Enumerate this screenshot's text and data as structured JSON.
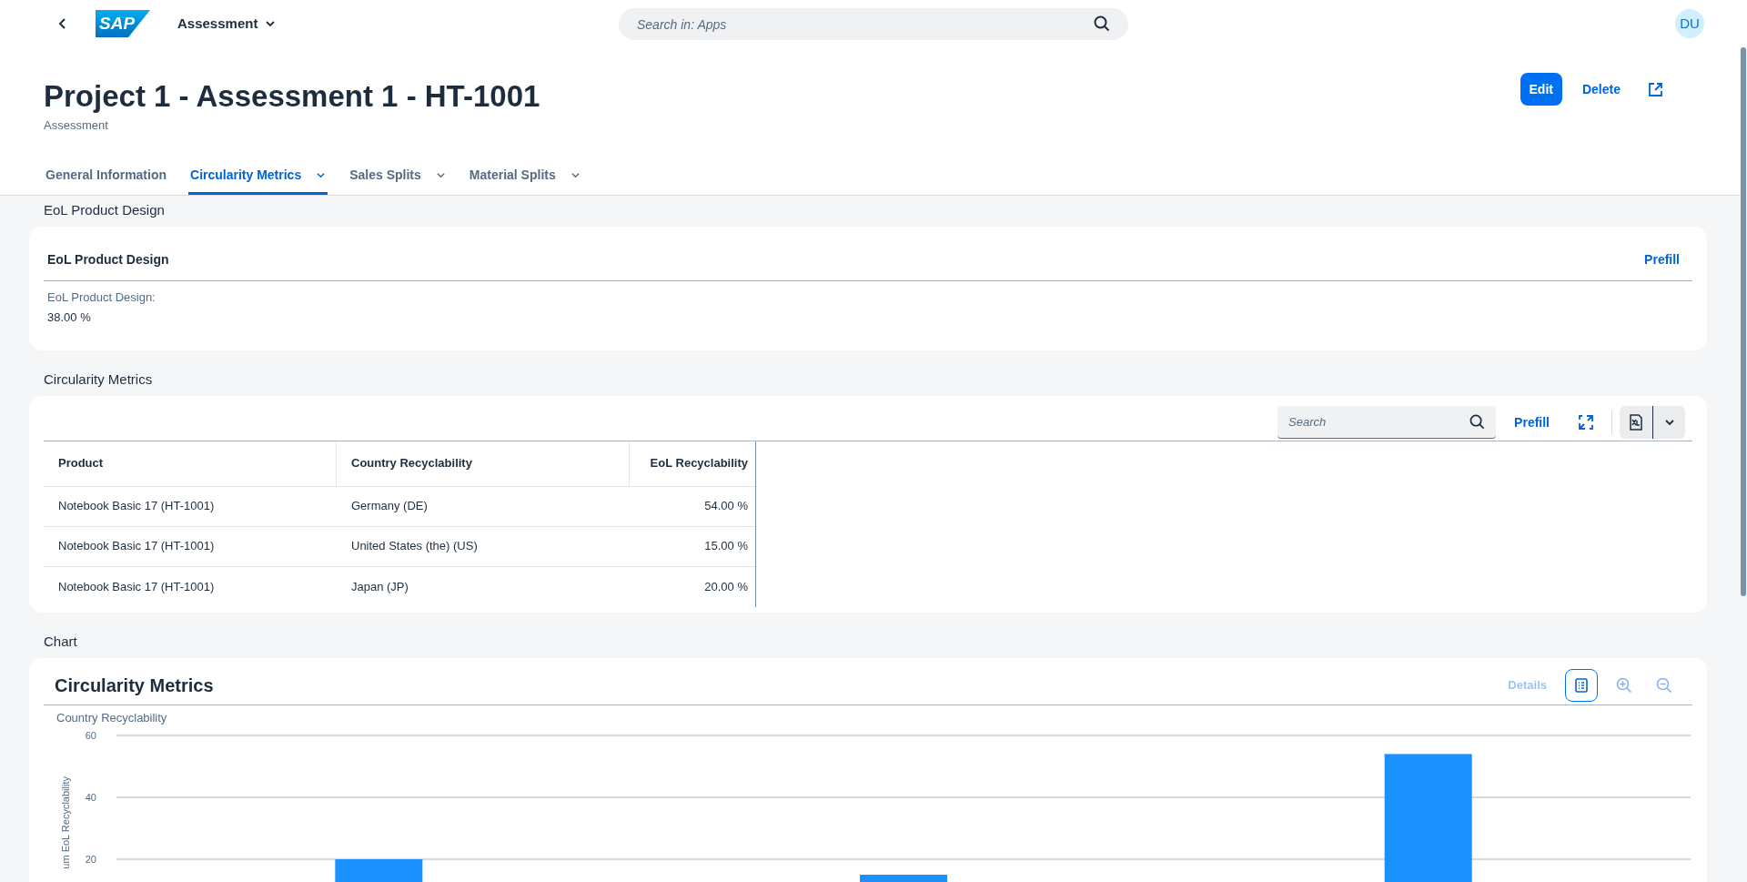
{
  "shell_bar": {
    "logo_text": "SAP",
    "app_title": "Assessment",
    "search": {
      "placeholder": "Search in: Apps"
    },
    "avatar": "DU"
  },
  "header": {
    "title": "Project 1 - Assessment 1 - HT-1001",
    "subtitle": "Assessment",
    "actions": [
      {
        "label": "Edit",
        "kind": "emphasized"
      },
      {
        "label": "Delete",
        "kind": "transparent"
      },
      {
        "kind": "icon"
      }
    ]
  },
  "tabs": [
    {
      "label": "General Information",
      "selected": false,
      "has_menu": false
    },
    {
      "label": "Circularity Metrics",
      "selected": true,
      "has_menu": true
    },
    {
      "label": "Sales Splits",
      "selected": false,
      "has_menu": true
    },
    {
      "label": "Material Splits",
      "selected": false,
      "has_menu": true
    }
  ],
  "eol_section": {
    "section_title": "EoL Product Design",
    "card_title": "EoL Product Design",
    "prefill": "Prefill",
    "field_label": "EoL Product Design:",
    "field_value": "38.00 %"
  },
  "metrics_section": {
    "section_title": "Circularity Metrics",
    "search": {
      "placeholder": "Search"
    },
    "prefill": "Prefill",
    "table": {
      "columns": [
        "Product",
        "Country Recyclability",
        "EoL Recyclability"
      ],
      "rows": [
        [
          "Notebook Basic 17 (HT-1001)",
          "Germany (DE)",
          "54.00 %"
        ],
        [
          "Notebook Basic 17 (HT-1001)",
          "United States (the) (US)",
          "15.00 %"
        ],
        [
          "Notebook Basic 17 (HT-1001)",
          "Japan (JP)",
          "20.00 %"
        ]
      ]
    }
  },
  "chart_section": {
    "section_title": "Chart",
    "card_title": "Circularity Metrics",
    "details": "Details",
    "chart_data": {
      "type": "bar",
      "ylabel": "um EoL Recyclability",
      "ylim": [
        0,
        60
      ],
      "yticks": [
        20,
        40,
        60
      ],
      "series": [
        {
          "name": "Country Recyclability",
          "color": "#1b90ff",
          "values": [
            20,
            15,
            54
          ]
        }
      ]
    }
  }
}
